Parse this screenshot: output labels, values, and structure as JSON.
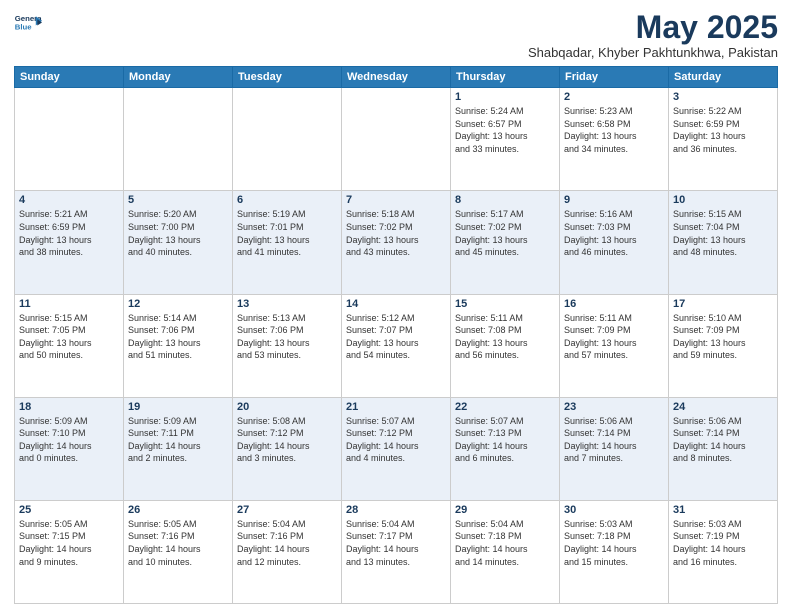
{
  "logo": {
    "line1": "General",
    "line2": "Blue"
  },
  "header": {
    "month": "May 2025",
    "location": "Shabqadar, Khyber Pakhtunkhwa, Pakistan"
  },
  "weekdays": [
    "Sunday",
    "Monday",
    "Tuesday",
    "Wednesday",
    "Thursday",
    "Friday",
    "Saturday"
  ],
  "weeks": [
    [
      {
        "day": "",
        "info": ""
      },
      {
        "day": "",
        "info": ""
      },
      {
        "day": "",
        "info": ""
      },
      {
        "day": "",
        "info": ""
      },
      {
        "day": "1",
        "info": "Sunrise: 5:24 AM\nSunset: 6:57 PM\nDaylight: 13 hours\nand 33 minutes."
      },
      {
        "day": "2",
        "info": "Sunrise: 5:23 AM\nSunset: 6:58 PM\nDaylight: 13 hours\nand 34 minutes."
      },
      {
        "day": "3",
        "info": "Sunrise: 5:22 AM\nSunset: 6:59 PM\nDaylight: 13 hours\nand 36 minutes."
      }
    ],
    [
      {
        "day": "4",
        "info": "Sunrise: 5:21 AM\nSunset: 6:59 PM\nDaylight: 13 hours\nand 38 minutes."
      },
      {
        "day": "5",
        "info": "Sunrise: 5:20 AM\nSunset: 7:00 PM\nDaylight: 13 hours\nand 40 minutes."
      },
      {
        "day": "6",
        "info": "Sunrise: 5:19 AM\nSunset: 7:01 PM\nDaylight: 13 hours\nand 41 minutes."
      },
      {
        "day": "7",
        "info": "Sunrise: 5:18 AM\nSunset: 7:02 PM\nDaylight: 13 hours\nand 43 minutes."
      },
      {
        "day": "8",
        "info": "Sunrise: 5:17 AM\nSunset: 7:02 PM\nDaylight: 13 hours\nand 45 minutes."
      },
      {
        "day": "9",
        "info": "Sunrise: 5:16 AM\nSunset: 7:03 PM\nDaylight: 13 hours\nand 46 minutes."
      },
      {
        "day": "10",
        "info": "Sunrise: 5:15 AM\nSunset: 7:04 PM\nDaylight: 13 hours\nand 48 minutes."
      }
    ],
    [
      {
        "day": "11",
        "info": "Sunrise: 5:15 AM\nSunset: 7:05 PM\nDaylight: 13 hours\nand 50 minutes."
      },
      {
        "day": "12",
        "info": "Sunrise: 5:14 AM\nSunset: 7:06 PM\nDaylight: 13 hours\nand 51 minutes."
      },
      {
        "day": "13",
        "info": "Sunrise: 5:13 AM\nSunset: 7:06 PM\nDaylight: 13 hours\nand 53 minutes."
      },
      {
        "day": "14",
        "info": "Sunrise: 5:12 AM\nSunset: 7:07 PM\nDaylight: 13 hours\nand 54 minutes."
      },
      {
        "day": "15",
        "info": "Sunrise: 5:11 AM\nSunset: 7:08 PM\nDaylight: 13 hours\nand 56 minutes."
      },
      {
        "day": "16",
        "info": "Sunrise: 5:11 AM\nSunset: 7:09 PM\nDaylight: 13 hours\nand 57 minutes."
      },
      {
        "day": "17",
        "info": "Sunrise: 5:10 AM\nSunset: 7:09 PM\nDaylight: 13 hours\nand 59 minutes."
      }
    ],
    [
      {
        "day": "18",
        "info": "Sunrise: 5:09 AM\nSunset: 7:10 PM\nDaylight: 14 hours\nand 0 minutes."
      },
      {
        "day": "19",
        "info": "Sunrise: 5:09 AM\nSunset: 7:11 PM\nDaylight: 14 hours\nand 2 minutes."
      },
      {
        "day": "20",
        "info": "Sunrise: 5:08 AM\nSunset: 7:12 PM\nDaylight: 14 hours\nand 3 minutes."
      },
      {
        "day": "21",
        "info": "Sunrise: 5:07 AM\nSunset: 7:12 PM\nDaylight: 14 hours\nand 4 minutes."
      },
      {
        "day": "22",
        "info": "Sunrise: 5:07 AM\nSunset: 7:13 PM\nDaylight: 14 hours\nand 6 minutes."
      },
      {
        "day": "23",
        "info": "Sunrise: 5:06 AM\nSunset: 7:14 PM\nDaylight: 14 hours\nand 7 minutes."
      },
      {
        "day": "24",
        "info": "Sunrise: 5:06 AM\nSunset: 7:14 PM\nDaylight: 14 hours\nand 8 minutes."
      }
    ],
    [
      {
        "day": "25",
        "info": "Sunrise: 5:05 AM\nSunset: 7:15 PM\nDaylight: 14 hours\nand 9 minutes."
      },
      {
        "day": "26",
        "info": "Sunrise: 5:05 AM\nSunset: 7:16 PM\nDaylight: 14 hours\nand 10 minutes."
      },
      {
        "day": "27",
        "info": "Sunrise: 5:04 AM\nSunset: 7:16 PM\nDaylight: 14 hours\nand 12 minutes."
      },
      {
        "day": "28",
        "info": "Sunrise: 5:04 AM\nSunset: 7:17 PM\nDaylight: 14 hours\nand 13 minutes."
      },
      {
        "day": "29",
        "info": "Sunrise: 5:04 AM\nSunset: 7:18 PM\nDaylight: 14 hours\nand 14 minutes."
      },
      {
        "day": "30",
        "info": "Sunrise: 5:03 AM\nSunset: 7:18 PM\nDaylight: 14 hours\nand 15 minutes."
      },
      {
        "day": "31",
        "info": "Sunrise: 5:03 AM\nSunset: 7:19 PM\nDaylight: 14 hours\nand 16 minutes."
      }
    ]
  ]
}
